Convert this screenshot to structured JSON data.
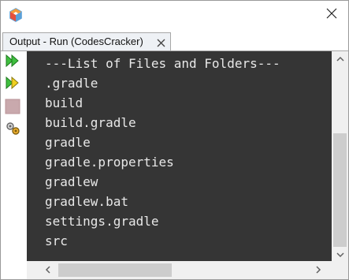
{
  "window": {
    "app_icon": "netbeans-cube-icon",
    "close_icon": "close-icon"
  },
  "tab": {
    "label": "Output - Run (CodesCracker)",
    "close_icon": "close-icon"
  },
  "toolbar": {
    "buttons": [
      {
        "icon": "rerun-icon"
      },
      {
        "icon": "rerun-with-params-icon"
      },
      {
        "icon": "stop-icon"
      },
      {
        "icon": "settings-icon"
      }
    ]
  },
  "console": {
    "lines": [
      "---List of Files and Folders---",
      ".gradle",
      "build",
      "build.gradle",
      "gradle",
      "gradle.properties",
      "gradlew",
      "gradlew.bat",
      "settings.gradle",
      "src"
    ],
    "background": "#353535",
    "text_color": "#e8e8e8"
  },
  "scrollbars": {
    "up_icon": "chevron-up-icon",
    "down_icon": "chevron-down-icon",
    "left_icon": "chevron-left-icon",
    "right_icon": "chevron-right-icon"
  }
}
